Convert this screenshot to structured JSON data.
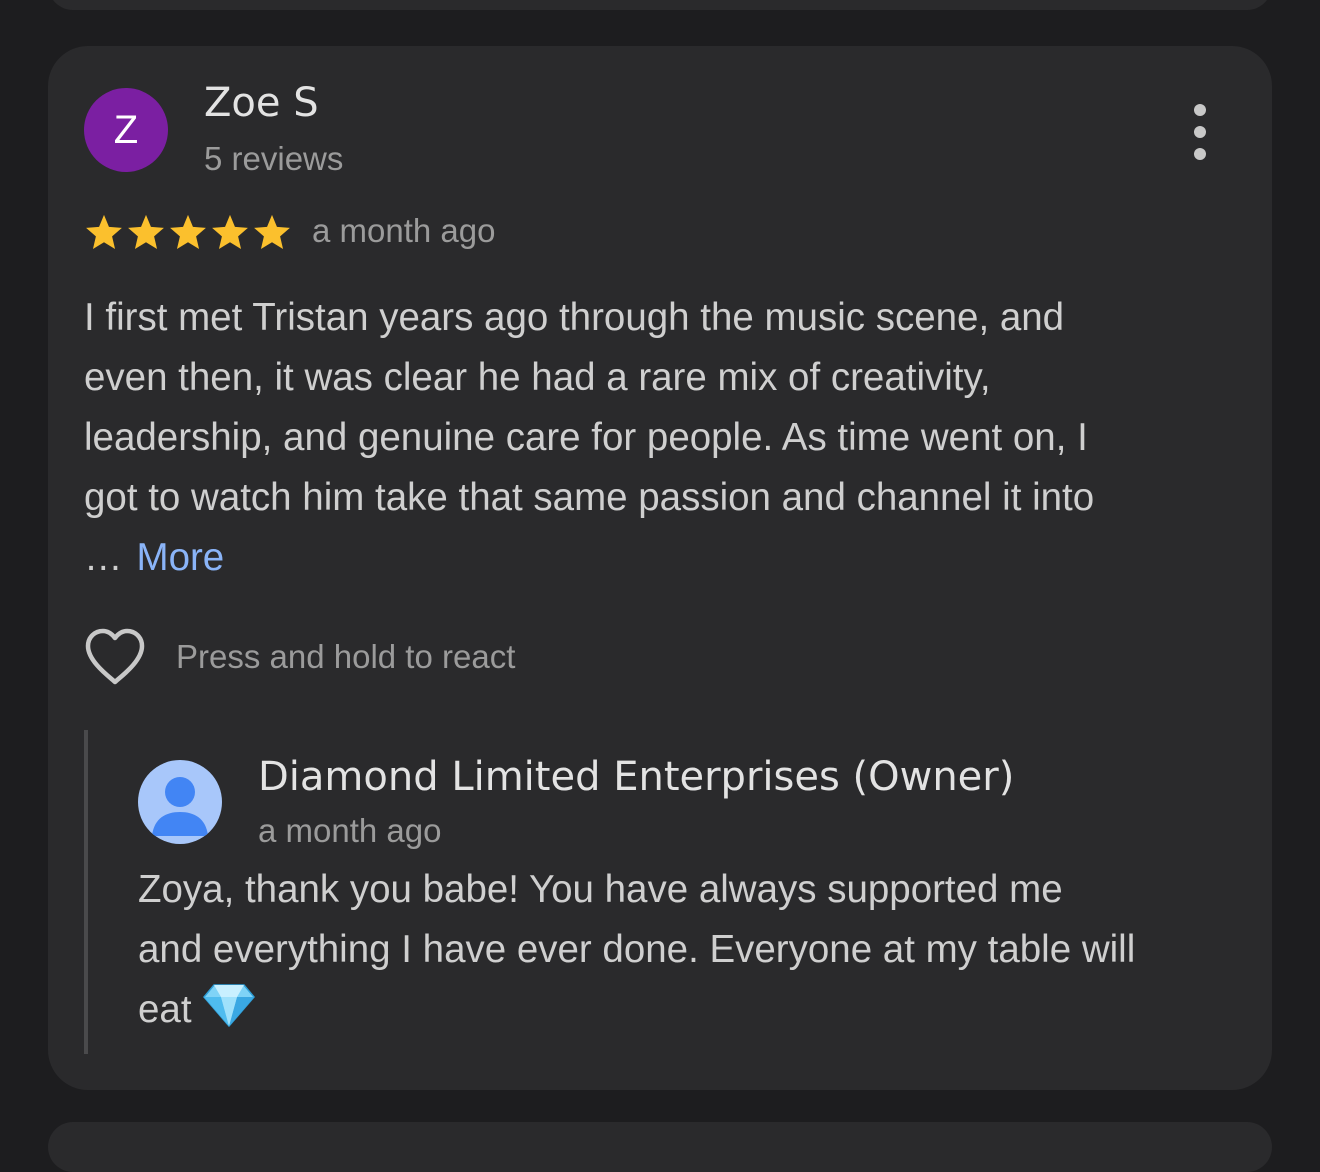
{
  "colors": {
    "background": "#1d1d1f",
    "card": "#2a2a2c",
    "avatar": "#7b1fa2",
    "owner_avatar": "#a8c7fa",
    "owner_avatar_figure": "#4285f4",
    "star": "#fbc02d",
    "link": "#8ab4f8"
  },
  "review": {
    "avatar_letter": "Z",
    "reviewer_name": "Zoe S",
    "review_count": "5 reviews",
    "rating": 5,
    "rating_max": 5,
    "time_ago": "a month ago",
    "body_lines": [
      "I first met Tristan years ago through the music scene, and",
      "even then, it was clear he had a rare mix of creativity,",
      "leadership, and genuine care for people. As time went on, I",
      "got to watch him take that same passion and channel it into"
    ],
    "ellipsis": "…",
    "more_label": "More",
    "menu_icon": "more-vert-icon"
  },
  "reactions": {
    "icon": "heart-outline-icon",
    "label": "Press and hold to react"
  },
  "owner_reply": {
    "avatar_icon": "person-icon",
    "owner_name": "Diamond Limited Enterprises (Owner)",
    "time_ago": "a month ago",
    "lines": [
      "Zoya, thank you babe! You have always supported me",
      "and everything I have ever done. Everyone at my table will",
      "eat"
    ],
    "emoji": "💎",
    "emoji_icon": "gem-icon"
  }
}
